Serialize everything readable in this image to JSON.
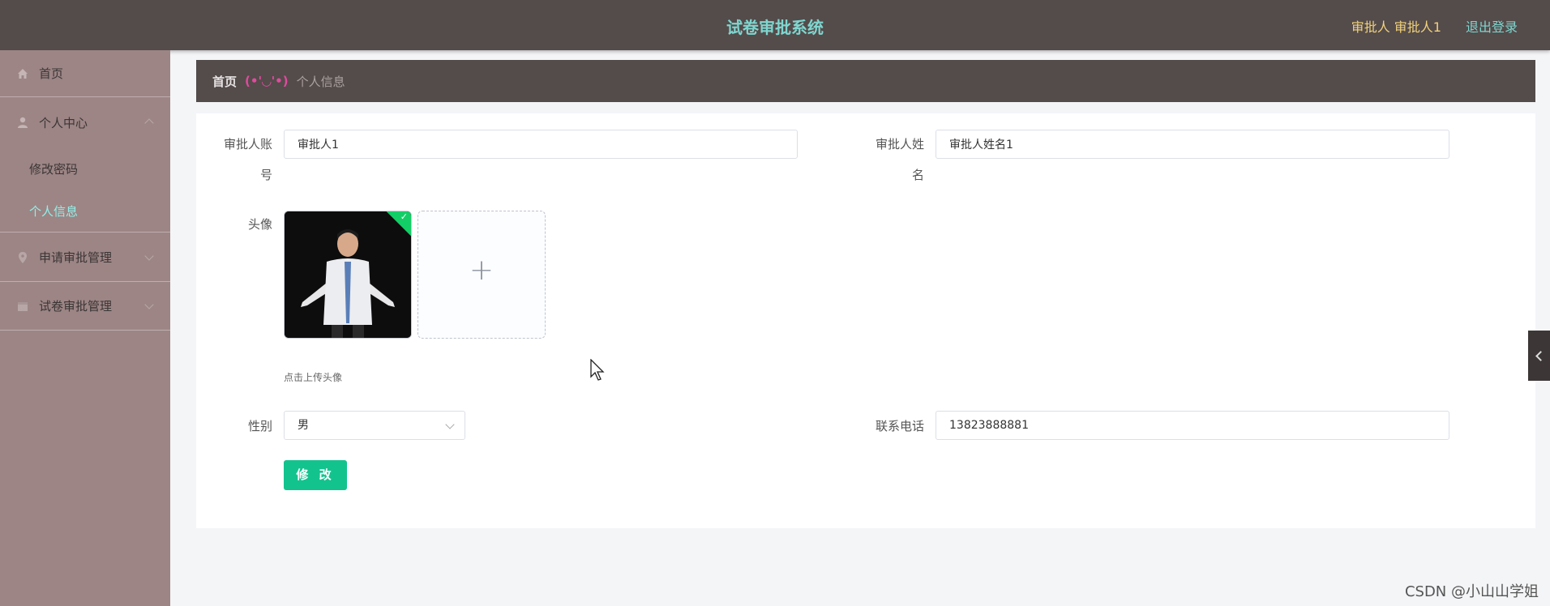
{
  "header": {
    "title": "试卷审批系统",
    "user_label": "审批人 审批人1",
    "logout": "退出登录"
  },
  "sidebar": {
    "items": [
      {
        "label": "首页",
        "icon": "home-icon"
      },
      {
        "label": "个人中心",
        "icon": "user-icon",
        "expanded": true,
        "children": [
          {
            "label": "修改密码"
          },
          {
            "label": "个人信息",
            "active": true
          }
        ]
      },
      {
        "label": "申请审批管理",
        "icon": "location-icon"
      },
      {
        "label": "试卷审批管理",
        "icon": "calendar-icon"
      }
    ]
  },
  "breadcrumb": {
    "home": "首页",
    "separator": "(•'◡'•)",
    "current": "个人信息"
  },
  "form": {
    "account_label_1": "审批人账",
    "account_label_2": "号",
    "account_value": "审批人1",
    "name_label_1": "审批人姓",
    "name_label_2": "名",
    "name_value": "审批人姓名1",
    "avatar_label": "头像",
    "avatar_hint": "点击上传头像",
    "gender_label": "性别",
    "gender_value": "男",
    "phone_label": "联系电话",
    "phone_value": "13823888881",
    "submit": "修 改"
  },
  "watermark": "CSDN @小山山学姐",
  "colors": {
    "header_bg": "#544b4b",
    "title": "#7fd6cf",
    "sidebar_bg": "#9d8585",
    "active_menu": "#8ff0ea",
    "button": "#13c38e",
    "avatar_badge": "#13ce66"
  }
}
